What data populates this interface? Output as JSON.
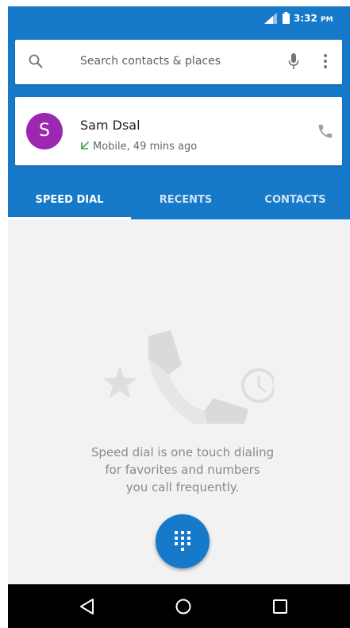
{
  "status_bar": {
    "time": "3:32",
    "time_suffix": "PM"
  },
  "search": {
    "placeholder": "Search contacts & places"
  },
  "recent_call": {
    "avatar_letter": "S",
    "name": "Sam Dsal",
    "detail": "Mobile, 49 mins ago",
    "avatar_color": "#9c27b0",
    "check_color": "#4caf50"
  },
  "tabs": [
    {
      "label": "SPEED DIAL",
      "active": true
    },
    {
      "label": "RECENTS",
      "active": false
    },
    {
      "label": "CONTACTS",
      "active": false
    }
  ],
  "empty_state": {
    "line1": "Speed dial is one touch dialing",
    "line2": "for favorites and numbers",
    "line3": "you call frequently."
  },
  "theme": {
    "primary": "#1679c9",
    "background": "#f2f2f2"
  },
  "icons": [
    "signal-icon",
    "battery-icon",
    "search-icon",
    "mic-icon",
    "more-vert-icon",
    "phone-icon",
    "check-icon",
    "star-icon",
    "clock-icon",
    "dialpad-icon",
    "back-icon",
    "home-icon",
    "recent-apps-icon"
  ]
}
